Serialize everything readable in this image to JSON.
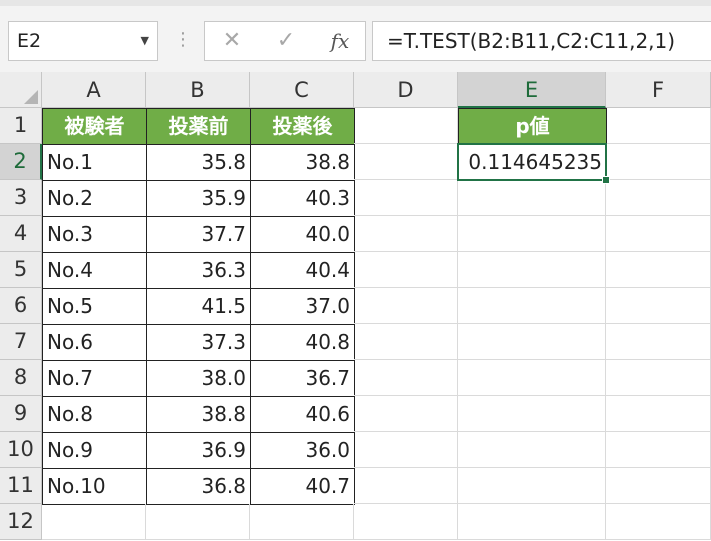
{
  "formula_bar": {
    "name_box": "E2",
    "formula": "=T.TEST(B2:B11,C2:C11,2,1)",
    "buttons": [
      {
        "name": "cancel-icon",
        "glyph": "✕"
      },
      {
        "name": "enter-icon",
        "glyph": "✓"
      },
      {
        "name": "insert-function-icon",
        "glyph": "fx"
      }
    ]
  },
  "columns": [
    "A",
    "B",
    "C",
    "D",
    "E",
    "F"
  ],
  "rows": [
    "1",
    "2",
    "3",
    "4",
    "5",
    "6",
    "7",
    "8",
    "9",
    "10",
    "11",
    "12"
  ],
  "cells": {
    "A1": "被験者",
    "B1": "投薬前",
    "C1": "投薬後",
    "E1": "p値",
    "A2": "No.1",
    "B2": "35.8",
    "C2": "38.8",
    "E2": "0.114645235",
    "A3": "No.2",
    "B3": "35.9",
    "C3": "40.3",
    "A4": "No.3",
    "B4": "37.7",
    "C4": "40.0",
    "A5": "No.4",
    "B5": "36.3",
    "C5": "40.4",
    "A6": "No.5",
    "B6": "41.5",
    "C6": "37.0",
    "A7": "No.6",
    "B7": "37.3",
    "C7": "40.8",
    "A8": "No.7",
    "B8": "38.0",
    "C8": "36.7",
    "A9": "No.8",
    "B9": "38.8",
    "C9": "40.6",
    "A10": "No.9",
    "B10": "36.9",
    "C10": "36.0",
    "A11": "No.10",
    "B11": "36.8",
    "C11": "40.7"
  },
  "colors": {
    "header_fill": "#70ad47",
    "selection": "#217346"
  },
  "selected_cell": "E2"
}
